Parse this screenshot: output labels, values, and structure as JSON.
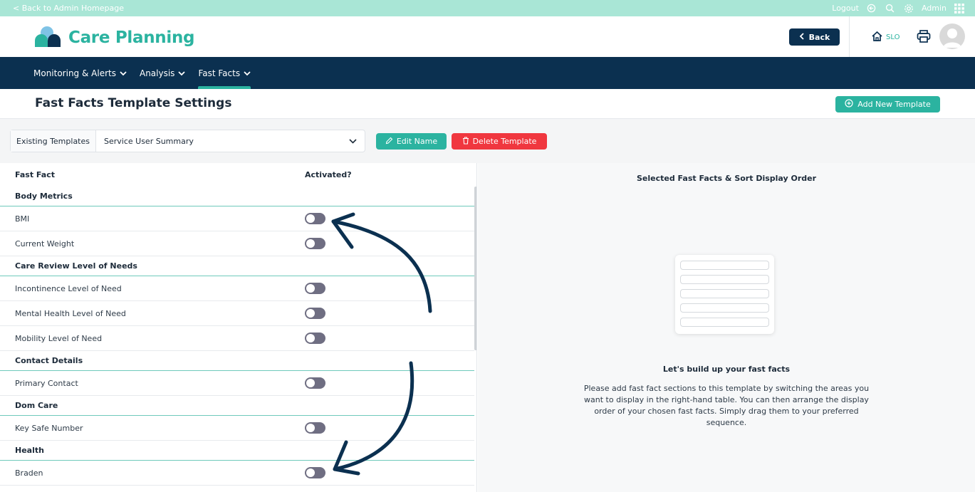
{
  "topbar": {
    "back_link": "< Back to Admin Homepage",
    "logout": "Logout",
    "admin": "Admin"
  },
  "header": {
    "app_title": "Care Planning",
    "back_button": "Back",
    "home_label": "SLO"
  },
  "nav": {
    "items": [
      {
        "label": "Monitoring & Alerts"
      },
      {
        "label": "Analysis"
      },
      {
        "label": "Fast Facts"
      }
    ],
    "active": "Fast Facts"
  },
  "page": {
    "title": "Fast Facts Template Settings",
    "add_button": "Add New Template"
  },
  "template_bar": {
    "label": "Existing Templates",
    "selected": "Service User Summary",
    "edit_button": "Edit Name",
    "delete_button": "Delete Template"
  },
  "table": {
    "col_fact": "Fast Fact",
    "col_active": "Activated?",
    "rows": [
      {
        "label": "Body Metrics",
        "section": true
      },
      {
        "label": "BMI",
        "activated": false
      },
      {
        "label": "Current Weight",
        "activated": false
      },
      {
        "label": "Care Review Level of Needs",
        "section": true
      },
      {
        "label": "Incontinence Level of Need",
        "activated": false
      },
      {
        "label": "Mental Health Level of Need",
        "activated": false
      },
      {
        "label": "Mobility Level of Need",
        "activated": false
      },
      {
        "label": "Contact Details",
        "section": true
      },
      {
        "label": "Primary Contact",
        "activated": false
      },
      {
        "label": "Dom Care",
        "section": true
      },
      {
        "label": "Key Safe Number",
        "activated": false
      },
      {
        "label": "Health",
        "section": true
      },
      {
        "label": "Braden",
        "activated": false
      }
    ]
  },
  "right_panel": {
    "title": "Selected Fast Facts & Sort Display Order",
    "empty_title": "Let's build up your fast facts",
    "empty_text": "Please add fast fact sections to this template by switching the areas you want to display in the right-hand table. You can then arrange the display order of your chosen fast facts. Simply drag them to your preferred sequence."
  },
  "colors": {
    "brand_teal": "#2bb3a0",
    "navy": "#0b3050",
    "danger": "#f0373f",
    "topbar": "#a9e6d6"
  }
}
